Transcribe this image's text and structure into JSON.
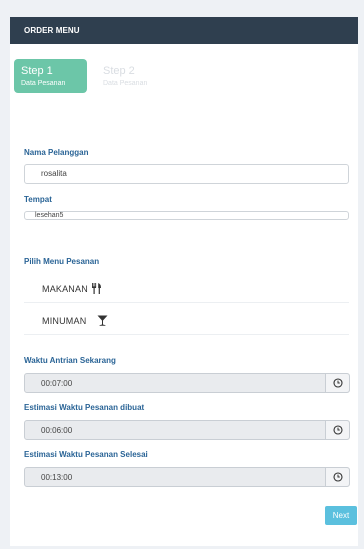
{
  "header": {
    "title": "ORDER MENU"
  },
  "steps": [
    {
      "number_label": "Step 1",
      "label": "Data Pesanan",
      "active": true
    },
    {
      "number_label": "Step 2",
      "label": "Data Pesanan",
      "active": false
    }
  ],
  "form": {
    "customer_name": {
      "label": "Nama Pelanggan",
      "value": "rosalita"
    },
    "place": {
      "label": "Tempat",
      "value": "lesehan5"
    },
    "menu_section": {
      "label": "Pilih Menu Pesanan",
      "items": [
        {
          "label": "MAKANAN",
          "icon": "cutlery-icon"
        },
        {
          "label": "MINUMAN",
          "icon": "cocktail-glass-icon"
        }
      ]
    },
    "queue_time": {
      "label": "Waktu Antrian Sekarang",
      "value": "00:07:00",
      "icon": "clock-icon"
    },
    "estimated_prep": {
      "label": "Estimasi Waktu Pesanan dibuat",
      "value": "00:06:00",
      "icon": "clock-icon"
    },
    "estimated_done": {
      "label": "Estimasi Waktu Pesanan Selesai",
      "value": "00:13:00",
      "icon": "clock-icon"
    }
  },
  "actions": {
    "next_label": "Next"
  },
  "colors": {
    "header_bg": "#2f3f4f",
    "active_step": "#6cc6a8",
    "label_text": "#2a6496",
    "next_button": "#5bc0de"
  }
}
